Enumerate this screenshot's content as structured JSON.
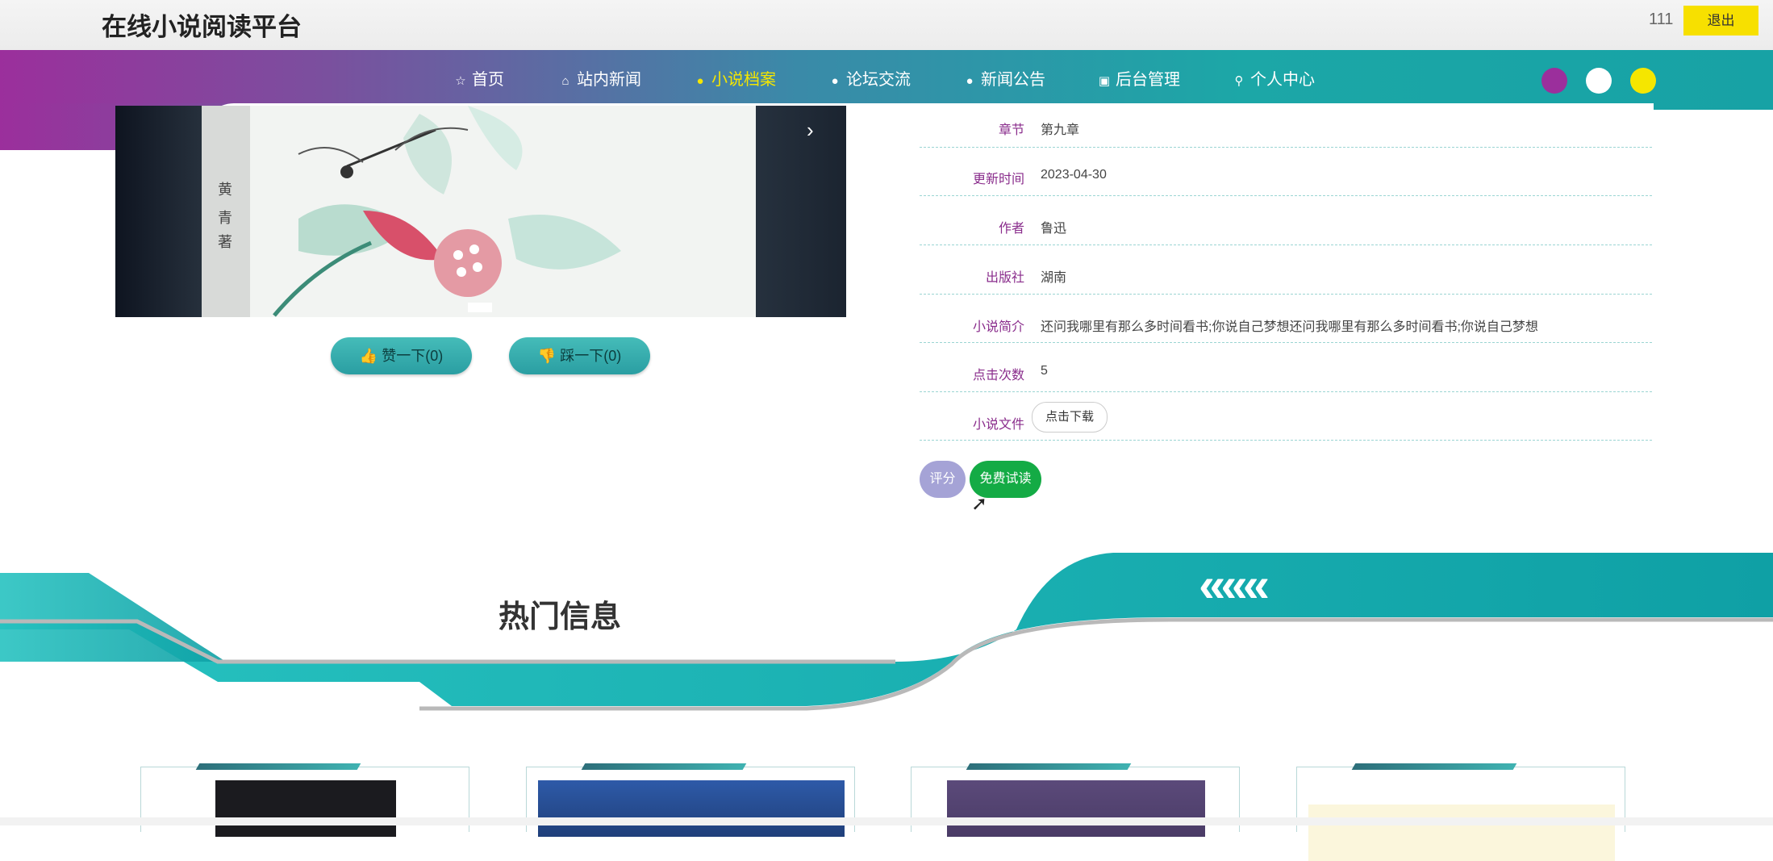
{
  "header": {
    "site_title": "在线小说阅读平台",
    "username": "111",
    "logout_label": "退出"
  },
  "nav": {
    "items": [
      {
        "label": "首页",
        "icon": "star-icon",
        "glyph": "☆"
      },
      {
        "label": "站内新闻",
        "icon": "bag-icon",
        "glyph": "⌂"
      },
      {
        "label": "小说档案",
        "icon": "info-icon",
        "glyph": "●",
        "active": true
      },
      {
        "label": "论坛交流",
        "icon": "question-icon",
        "glyph": "●"
      },
      {
        "label": "新闻公告",
        "icon": "alert-icon",
        "glyph": "●"
      },
      {
        "label": "后台管理",
        "icon": "box-icon",
        "glyph": "▣"
      },
      {
        "label": "个人中心",
        "icon": "user-icon",
        "glyph": "⚲"
      }
    ],
    "theme_colors": [
      "#9b2f9c",
      "#ffffff",
      "#f5e600"
    ]
  },
  "slider": {
    "next_glyph": "›"
  },
  "votes": {
    "like_label": "赞一下(0)",
    "dislike_label": "踩一下(0)"
  },
  "details": [
    {
      "label": "章节",
      "value": "第九章"
    },
    {
      "label": "更新时间",
      "value": "2023-04-30"
    },
    {
      "label": "作者",
      "value": "鲁迅"
    },
    {
      "label": "出版社",
      "value": "湖南"
    },
    {
      "label": "小说简介",
      "value": "还问我哪里有那么多时间看书;你说自己梦想还问我哪里有那么多时间看书;你说自己梦想"
    },
    {
      "label": "点击次数",
      "value": "5"
    },
    {
      "label": "小说文件",
      "value": ""
    }
  ],
  "download_label": "点击下载",
  "actions": {
    "rate_label": "评分",
    "read_label": "免费试读"
  },
  "hot": {
    "title": "热门信息",
    "chevrons": "«««"
  },
  "colors": {
    "accent_teal": "#17a2a5",
    "accent_purple": "#9b2f9c",
    "accent_yellow": "#f7e000",
    "label_purple": "#8a2d8c",
    "read_green": "#14ab45"
  }
}
